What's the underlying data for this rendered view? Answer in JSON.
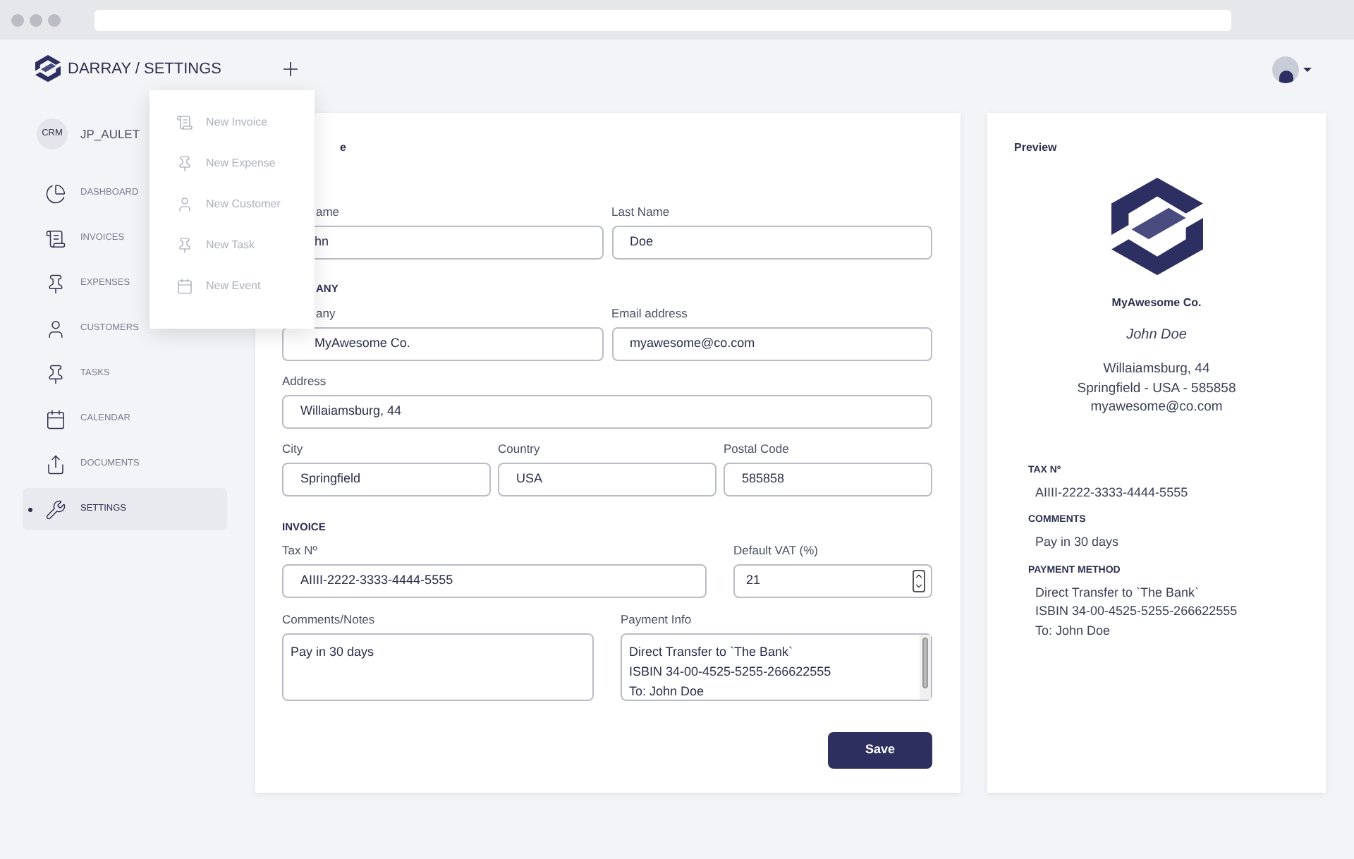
{
  "header": {
    "brand": "DARRAY / SETTINGS"
  },
  "new_menu": {
    "items": [
      {
        "label": "New Invoice"
      },
      {
        "label": "New Expense"
      },
      {
        "label": "New Customer"
      },
      {
        "label": "New Task"
      },
      {
        "label": "New Event"
      }
    ]
  },
  "sidebar": {
    "badge": "CRM",
    "user": "JP_AULET",
    "items": [
      {
        "label": "DASHBOARD",
        "selected": false
      },
      {
        "label": "INVOICES",
        "selected": false
      },
      {
        "label": "EXPENSES",
        "selected": false
      },
      {
        "label": "CUSTOMERS",
        "selected": false
      },
      {
        "label": "TASKS",
        "selected": false
      },
      {
        "label": "CALENDAR",
        "selected": false
      },
      {
        "label": "DOCUMENTS",
        "selected": false
      },
      {
        "label": "SETTINGS",
        "selected": true
      }
    ]
  },
  "form": {
    "title": "e",
    "blocks": [
      {
        "kind": "row",
        "fields": [
          {
            "label": "ame",
            "value": "hn",
            "kind": "text"
          },
          {
            "label": "Last Name",
            "value": "Doe",
            "kind": "text"
          }
        ]
      },
      {
        "kind": "heading",
        "text": "ANY"
      },
      {
        "kind": "row",
        "fields": [
          {
            "label": "any",
            "value": "MyAwesome Co.",
            "kind": "text"
          },
          {
            "label": "Email address",
            "value": "myawesome@co.com",
            "kind": "text"
          }
        ]
      },
      {
        "kind": "row",
        "fields": [
          {
            "label": "Address",
            "value": "Willaiamsburg, 44",
            "kind": "text"
          }
        ]
      },
      {
        "kind": "row",
        "fields": [
          {
            "label": "City",
            "value": "Springfield",
            "kind": "text"
          },
          {
            "label": "Country",
            "value": "USA",
            "kind": "text"
          },
          {
            "label": "Postal Code",
            "value": "585858",
            "kind": "text"
          }
        ]
      },
      {
        "kind": "heading",
        "text": "INVOICE"
      },
      {
        "kind": "row",
        "fields": [
          {
            "label": "Tax Nº",
            "value": "AIIII-2222-3333-4444-5555",
            "kind": "text"
          },
          {
            "label": "Default VAT (%)",
            "value": "21",
            "kind": "number"
          }
        ]
      },
      {
        "kind": "row",
        "fields": [
          {
            "label": "Comments/Notes",
            "lines": [
              "Pay in 30 days"
            ],
            "kind": "textarea"
          },
          {
            "label": "Payment Info",
            "lines": [
              "Direct Transfer to `The Bank`",
              "ISBIN 34-00-4525-5255-266622555",
              "To: John Doe"
            ],
            "kind": "scroll_textarea"
          }
        ]
      }
    ],
    "save": "Save"
  },
  "preview": {
    "title": "Preview",
    "company": "MyAwesome Co.",
    "contact": "John Doe",
    "address_lines": [
      "Willaiamsburg, 44",
      "Springfield - USA - 585858",
      "myawesome@co.com"
    ],
    "sections": [
      {
        "heading": "TAX Nº",
        "lines": [
          "AIIII-2222-3333-4444-5555"
        ]
      },
      {
        "heading": "COMMENTS",
        "lines": [
          "Pay in 30 days"
        ]
      },
      {
        "heading": "PAYMENT METHOD",
        "lines": [
          "Direct Transfer to `The Bank`",
          "ISBIN 34-00-4525-5255-266622555",
          "To: John Doe"
        ]
      }
    ]
  }
}
